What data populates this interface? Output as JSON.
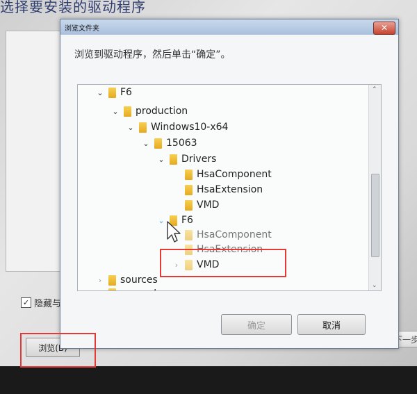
{
  "background": {
    "title": "选择要安装的驱动程序",
    "hide_checkbox_label": "隐藏与此",
    "hide_checked": "✓",
    "browse_label": "浏览(B)",
    "next_label": "下一步"
  },
  "dialog": {
    "title": "浏览文件夹",
    "close_glyph": "✕",
    "instruction": "浏览到驱动程序，然后单击“确定”。",
    "ok_label": "确定",
    "cancel_label": "取消"
  },
  "tree": {
    "expand_open": "⌄",
    "expand_closed": "›",
    "scroll_up": "⌃",
    "scroll_down": "⌄",
    "items": [
      {
        "label": "F6",
        "level": 1,
        "expanded": true
      },
      {
        "label": "production",
        "level": 2,
        "expanded": true
      },
      {
        "label": "Windows10-x64",
        "level": 3,
        "expanded": true
      },
      {
        "label": "15063",
        "level": 4,
        "expanded": true
      },
      {
        "label": "Drivers",
        "level": 5,
        "expanded": true
      },
      {
        "label": "HsaComponent",
        "level": 6
      },
      {
        "label": "HsaExtension",
        "level": 6
      },
      {
        "label": "VMD",
        "level": 6
      },
      {
        "label": "F6",
        "level": 5,
        "expanded": true
      },
      {
        "label": "HsaComponent",
        "level": 6
      },
      {
        "label": "HsaExtension",
        "level": 6
      },
      {
        "label": "VMD",
        "level": 6,
        "expandable": true
      },
      {
        "label": "sources",
        "level": 1
      },
      {
        "label": "support",
        "level": 1
      }
    ]
  },
  "colors": {
    "highlight": "#e53935",
    "folder": "#f2c03c"
  }
}
